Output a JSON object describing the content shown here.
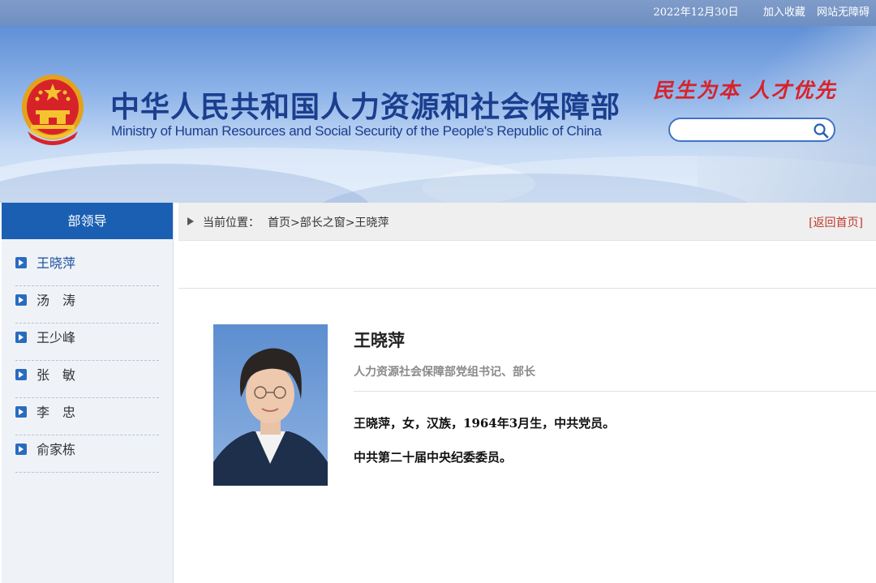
{
  "topbar": {
    "date": "2022年12月30日",
    "favorite_label": "加入收藏",
    "accessibility_label": "网站无障碍"
  },
  "header": {
    "title_cn": "中华人民共和国人力资源和社会保障部",
    "title_en": "Ministry of Human Resources and Social Security of the People's Republic of China",
    "slogan": "民生为本 人才优先",
    "search": {
      "placeholder": "",
      "value": "",
      "icon": "search-icon"
    }
  },
  "sidebar": {
    "title": "部领导",
    "items": [
      {
        "label": "王晓萍",
        "active": true
      },
      {
        "label": "汤　涛",
        "active": false
      },
      {
        "label": "王少峰",
        "active": false
      },
      {
        "label": "张　敏",
        "active": false
      },
      {
        "label": "李　忠",
        "active": false
      },
      {
        "label": "俞家栋",
        "active": false
      }
    ]
  },
  "breadcrumb": {
    "prefix": "当前位置：",
    "path": [
      "首页",
      "部长之窗",
      "王晓萍"
    ],
    "separator": ">",
    "back_home": "[返回首页]"
  },
  "profile": {
    "name": "王晓萍",
    "title": "人力资源社会保障部党组书记、部长",
    "bio": [
      "王晓萍，女，汉族，1964年3月生，中共党员。",
      "中共第二十届中央纪委委员。"
    ]
  },
  "colors": {
    "brand_blue": "#1b3e8e",
    "sidebar_header": "#1b5fb3",
    "slogan_red": "#d8222a",
    "back_home_red": "#c0392b"
  }
}
